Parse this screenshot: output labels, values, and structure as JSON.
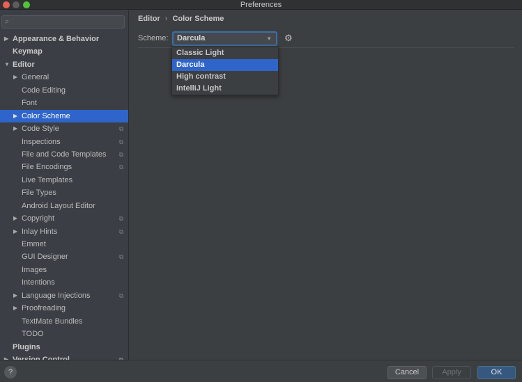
{
  "window": {
    "title": "Preferences"
  },
  "search": {
    "placeholder": "",
    "icon": "search-icon"
  },
  "tree": [
    {
      "label": "Appearance & Behavior",
      "level": 0,
      "bold": true,
      "arrow": "right",
      "project": false
    },
    {
      "label": "Keymap",
      "level": 0,
      "bold": true,
      "arrow": "",
      "project": false
    },
    {
      "label": "Editor",
      "level": 0,
      "bold": true,
      "arrow": "down",
      "project": false
    },
    {
      "label": "General",
      "level": 1,
      "arrow": "right",
      "project": false
    },
    {
      "label": "Code Editing",
      "level": 1,
      "arrow": "",
      "project": false
    },
    {
      "label": "Font",
      "level": 1,
      "arrow": "",
      "project": false
    },
    {
      "label": "Color Scheme",
      "level": 1,
      "arrow": "right",
      "project": false,
      "selected": true
    },
    {
      "label": "Code Style",
      "level": 1,
      "arrow": "right",
      "project": true
    },
    {
      "label": "Inspections",
      "level": 1,
      "arrow": "",
      "project": true
    },
    {
      "label": "File and Code Templates",
      "level": 1,
      "arrow": "",
      "project": true
    },
    {
      "label": "File Encodings",
      "level": 1,
      "arrow": "",
      "project": true
    },
    {
      "label": "Live Templates",
      "level": 1,
      "arrow": "",
      "project": false
    },
    {
      "label": "File Types",
      "level": 1,
      "arrow": "",
      "project": false
    },
    {
      "label": "Android Layout Editor",
      "level": 1,
      "arrow": "",
      "project": false
    },
    {
      "label": "Copyright",
      "level": 1,
      "arrow": "right",
      "project": true
    },
    {
      "label": "Inlay Hints",
      "level": 1,
      "arrow": "right",
      "project": true
    },
    {
      "label": "Emmet",
      "level": 1,
      "arrow": "",
      "project": false
    },
    {
      "label": "GUI Designer",
      "level": 1,
      "arrow": "",
      "project": true
    },
    {
      "label": "Images",
      "level": 1,
      "arrow": "",
      "project": false
    },
    {
      "label": "Intentions",
      "level": 1,
      "arrow": "",
      "project": false
    },
    {
      "label": "Language Injections",
      "level": 1,
      "arrow": "right",
      "project": true
    },
    {
      "label": "Proofreading",
      "level": 1,
      "arrow": "right",
      "project": false
    },
    {
      "label": "TextMate Bundles",
      "level": 1,
      "arrow": "",
      "project": false
    },
    {
      "label": "TODO",
      "level": 1,
      "arrow": "",
      "project": false
    },
    {
      "label": "Plugins",
      "level": 0,
      "bold": true,
      "arrow": "",
      "project": false
    },
    {
      "label": "Version Control",
      "level": 0,
      "bold": true,
      "arrow": "right",
      "project": true
    }
  ],
  "breadcrumb": {
    "parent": "Editor",
    "separator": "›",
    "current": "Color Scheme"
  },
  "scheme": {
    "label": "Scheme:",
    "value": "Darcula",
    "options": [
      "Classic Light",
      "Darcula",
      "High contrast",
      "IntelliJ Light"
    ],
    "selected_index": 1
  },
  "buttons": {
    "help": "?",
    "cancel": "Cancel",
    "apply": "Apply",
    "ok": "OK"
  },
  "colors": {
    "selection": "#2f65ca",
    "ok_button": "#365880"
  }
}
